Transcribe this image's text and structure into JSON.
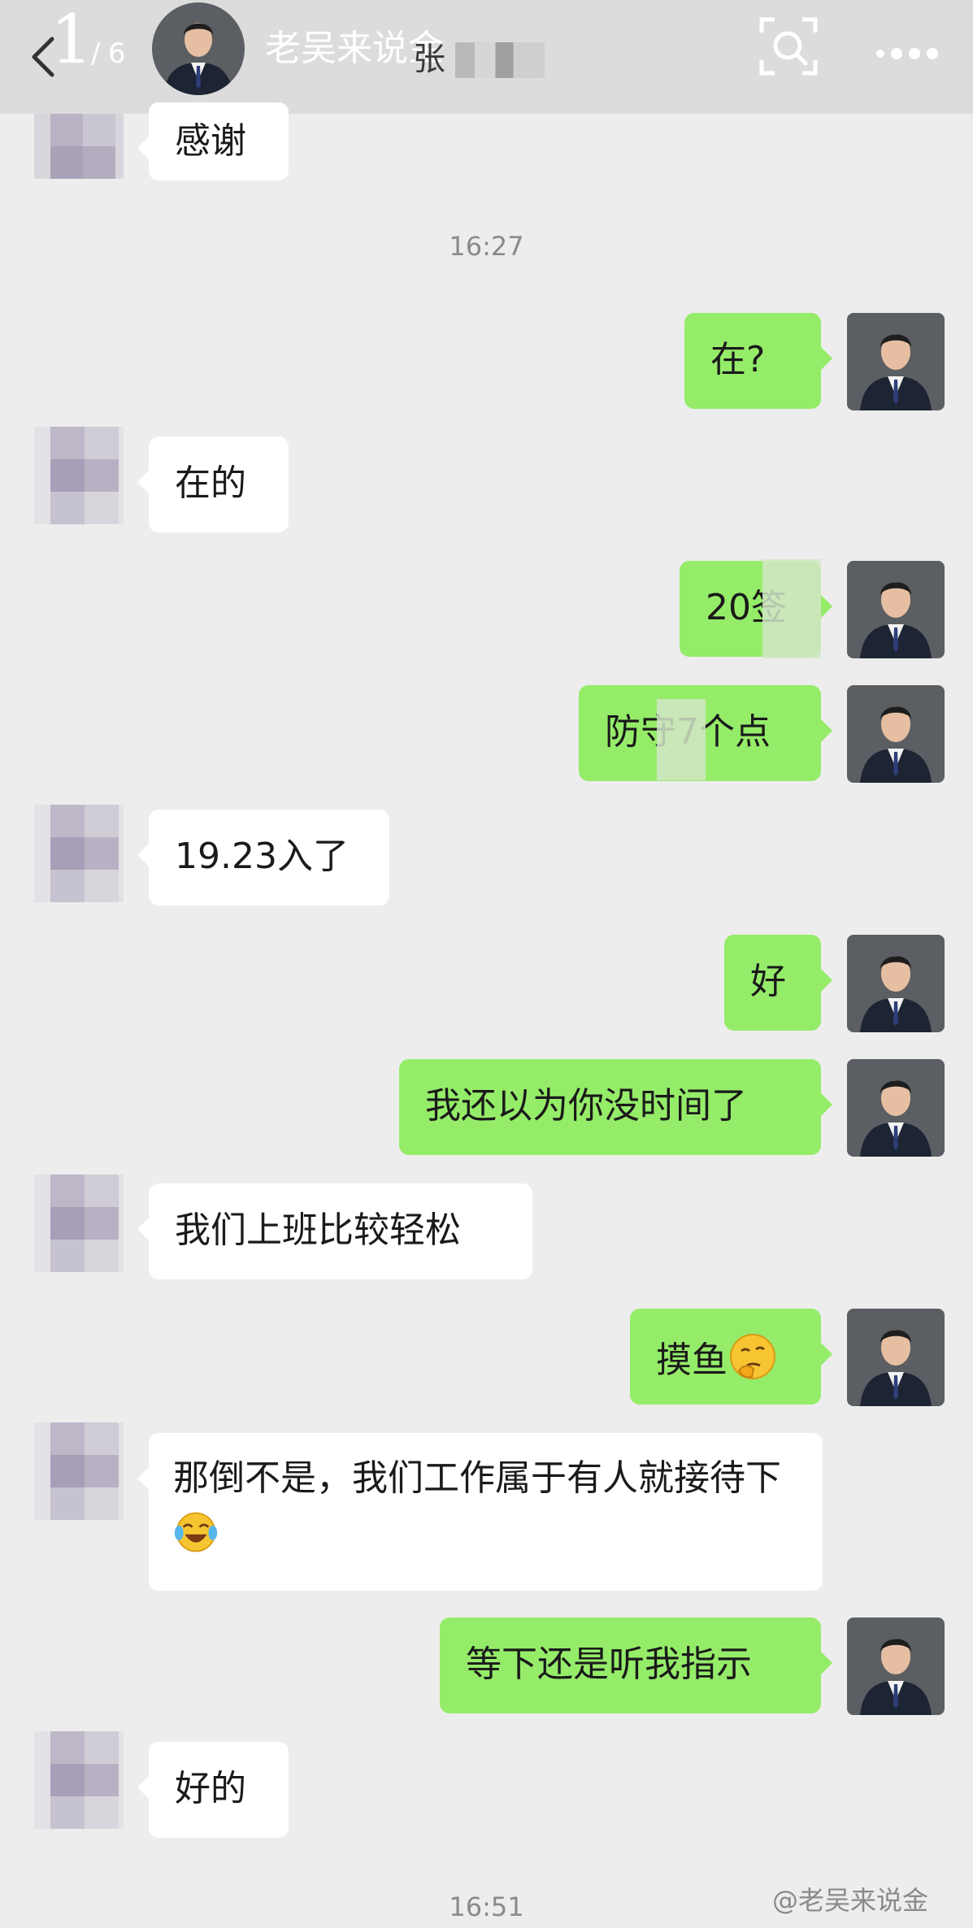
{
  "header": {
    "page_current": "1",
    "page_separator": "/",
    "page_total": "6",
    "account_name": "老吴来说金",
    "contact_name_partial": "张"
  },
  "messages": [
    {
      "side": "in",
      "text": "感谢"
    },
    {
      "type": "time",
      "text": "16:27"
    },
    {
      "side": "out",
      "text": "在?"
    },
    {
      "side": "in",
      "text": "在的"
    },
    {
      "side": "out",
      "text": "20签"
    },
    {
      "side": "out",
      "text": "防守7个点"
    },
    {
      "side": "in",
      "text": "19.23入了"
    },
    {
      "side": "out",
      "text": "好"
    },
    {
      "side": "out",
      "text": "我还以为你没时间了"
    },
    {
      "side": "in",
      "text": "我们上班比较轻松"
    },
    {
      "side": "out",
      "text": "摸鱼",
      "emoji": "thinking-face-icon"
    },
    {
      "side": "in",
      "text": "那倒不是，我们工作属于有人就接待下",
      "emoji": "tears-of-joy-icon"
    },
    {
      "side": "out",
      "text": "等下还是听我指示"
    },
    {
      "side": "in",
      "text": "好的"
    },
    {
      "type": "time",
      "text": "16:51"
    }
  ],
  "watermark": "@老吴来说金",
  "colors": {
    "chat_background": "#ededed",
    "outgoing_bubble": "#95ec69",
    "incoming_bubble": "#ffffff",
    "header_background": "#dcdcdc"
  }
}
